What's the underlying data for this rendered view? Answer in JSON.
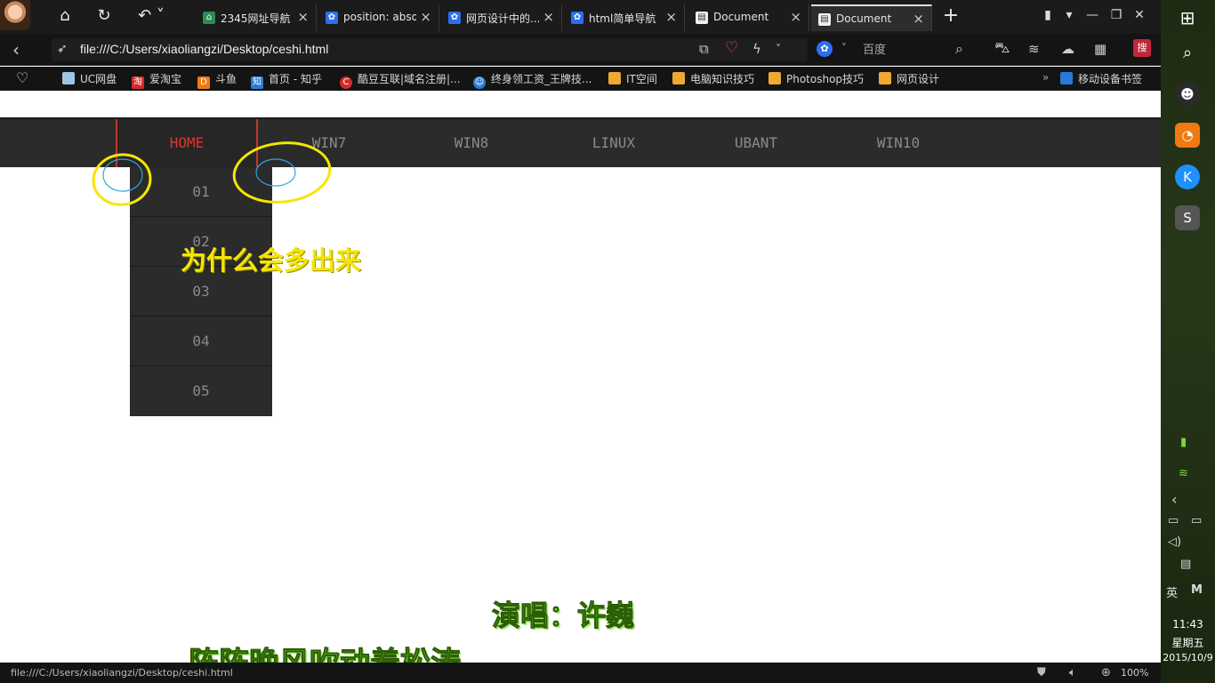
{
  "browser": {
    "tabs": [
      {
        "title": "2345网址导航",
        "icon": "house-icon"
      },
      {
        "title": "position: absolute",
        "icon": "paw-icon"
      },
      {
        "title": "网页设计中的...",
        "icon": "paw-icon"
      },
      {
        "title": "html简单导航",
        "icon": "paw-icon"
      },
      {
        "title": "Document",
        "icon": "document-icon"
      },
      {
        "title": "Document",
        "icon": "document-icon",
        "active": true
      }
    ],
    "address": {
      "url": "file:///C:/Users/xiaoliangzi/Desktop/ceshi.html"
    },
    "search": {
      "placeholder": "百度"
    },
    "bookmarks": [
      {
        "label": "UC网盘",
        "icon": "cloud-icon"
      },
      {
        "label": "爱淘宝",
        "icon": "taobao-icon"
      },
      {
        "label": "斗鱼",
        "icon": "douyu-icon"
      },
      {
        "label": "首页 - 知乎",
        "icon": "zhihu-icon"
      },
      {
        "label": "酷豆互联|域名注册|...",
        "icon": "kudou-icon"
      },
      {
        "label": "终身领工资_王牌技...",
        "icon": "game-icon"
      },
      {
        "label": "IT空间",
        "icon": "folder-icon"
      },
      {
        "label": "电脑知识技巧",
        "icon": "folder-icon"
      },
      {
        "label": "Photoshop技巧",
        "icon": "folder-icon"
      },
      {
        "label": "网页设计",
        "icon": "folder-icon"
      },
      {
        "label": "移动设备书签",
        "icon": "folder-icon"
      }
    ],
    "status": {
      "url": "file:///C:/Users/xiaoliangzi/Desktop/ceshi.html",
      "zoom": "100%"
    }
  },
  "page": {
    "nav": [
      "HOME",
      "WIN7",
      "WIN8",
      "LINUX",
      "UBANT",
      "WIN10"
    ],
    "dropdown": [
      "01",
      "02",
      "03",
      "04",
      "05"
    ],
    "annotation": "为什么会多出来",
    "lyrics": {
      "singer": "演唱：许巍",
      "line": "阵阵晚风吹动着松涛"
    }
  },
  "taskbar": {
    "ime": "英",
    "ime_mode": "M",
    "time": "11:43",
    "day": "星期五",
    "date": "2015/10/9"
  },
  "colors": {
    "nav_bg": "#2b2b2b",
    "nav_active": "#e0352f",
    "annotation": "#f5e600",
    "lyric": "#6fd41c"
  }
}
